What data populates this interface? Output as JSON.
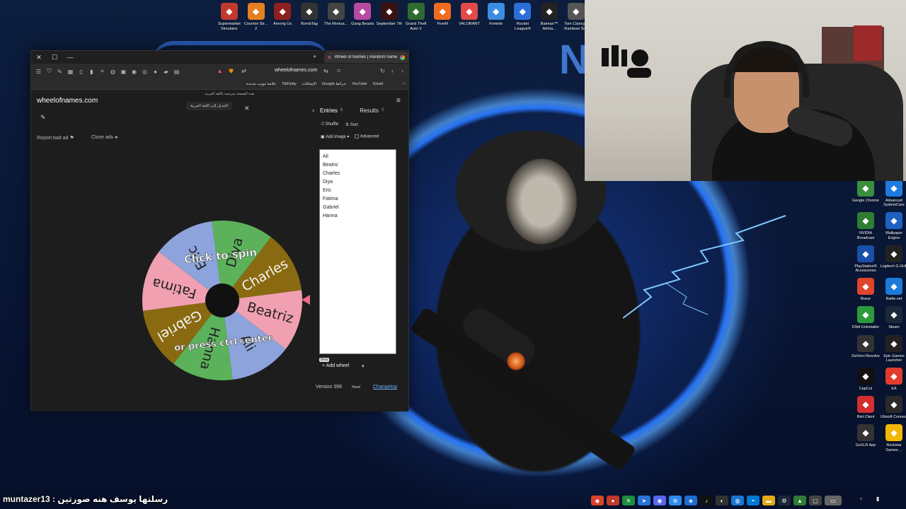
{
  "desktop": {
    "top_icons": [
      {
        "label": "Supermarket Simulator",
        "icon": "supermarket-icon",
        "color": "#c0392b"
      },
      {
        "label": "Counter-Str... 2",
        "icon": "cs2-icon",
        "color": "#e67e22"
      },
      {
        "label": "Among Us",
        "icon": "among-us-icon",
        "color": "#8e1f1f"
      },
      {
        "label": "BombTag",
        "icon": "bombtag-icon",
        "color": "#333333"
      },
      {
        "label": "The Mortua...",
        "icon": "mortuary-icon",
        "color": "#444444"
      },
      {
        "label": "Gang Beasts",
        "icon": "gang-beasts-icon",
        "color": "#b84aa3"
      },
      {
        "label": "September 7th",
        "icon": "september-icon",
        "color": "#3a1111"
      },
      {
        "label": "Grand Theft Auto V",
        "icon": "gta-icon",
        "color": "#2f6b2f"
      },
      {
        "label": "FiveM",
        "icon": "fivem-icon",
        "color": "#f06b1f"
      },
      {
        "label": "VALORANT",
        "icon": "valorant-icon",
        "color": "#e34a4a"
      },
      {
        "label": "Fortnite",
        "icon": "fortnite-icon",
        "color": "#3b8de0"
      },
      {
        "label": "Rocket League®",
        "icon": "rocket-league-icon",
        "color": "#2a6fd6"
      },
      {
        "label": "Batman™ Arkha...",
        "icon": "batman-icon",
        "color": "#222222"
      },
      {
        "label": "Tom Clancy's Rainbow Si...",
        "icon": "rainbow-six-icon",
        "color": "#555555"
      }
    ],
    "right_icons": [
      {
        "label": "Google Chrome",
        "icon": "chrome-icon",
        "color": "#3b8e3b"
      },
      {
        "label": "Advanced SystemCare",
        "icon": "systemcare-icon",
        "color": "#1f7ae0"
      },
      {
        "label": "NVIDIA Broadcast",
        "icon": "nvidia-icon",
        "color": "#2e7d32"
      },
      {
        "label": "Wallpaper Engine",
        "icon": "wallpaper-engine-icon",
        "color": "#1f5fbf"
      },
      {
        "label": "PlayStation® Accessories",
        "icon": "playstation-icon",
        "color": "#1a4fa8"
      },
      {
        "label": "Logitech G HUB",
        "icon": "logitech-icon",
        "color": "#222222"
      },
      {
        "label": "Brave",
        "icon": "brave-icon",
        "color": "#e0452b"
      },
      {
        "label": "Battle.net",
        "icon": "battlenet-icon",
        "color": "#1c7ad9"
      },
      {
        "label": "IObit Uninstaller",
        "icon": "iobit-icon",
        "color": "#2c9a3c"
      },
      {
        "label": "Steam",
        "icon": "steam-icon",
        "color": "#1b2838"
      },
      {
        "label": "DaVinci Resolve",
        "icon": "davinci-icon",
        "color": "#333333"
      },
      {
        "label": "Epic Games Launcher",
        "icon": "epic-icon",
        "color": "#222222"
      },
      {
        "label": "CapCut",
        "icon": "capcut-icon",
        "color": "#111111"
      },
      {
        "label": "EA",
        "icon": "ea-icon",
        "color": "#e23c2c"
      },
      {
        "label": "Riot Client",
        "icon": "riot-icon",
        "color": "#d32f2f"
      },
      {
        "label": "Ubisoft Connect",
        "icon": "ubisoft-icon",
        "color": "#2a2a2a"
      },
      {
        "label": "GoXLR App",
        "icon": "goxlr-icon",
        "color": "#333333"
      },
      {
        "label": "Rockstar Games ...",
        "icon": "rockstar-icon",
        "color": "#f2b705"
      }
    ]
  },
  "browser": {
    "tab_title": "Wheel of Names | Random name",
    "url": "wheelofnames.com",
    "bookmarks": [
      "علامة تبويب جديدة",
      "TikFinity",
      "الإضافات",
      "Google خرائط",
      "YouTube",
      "Gmail"
    ],
    "translate_popup": {
      "text": "هذه الصفحة مترجمة باللغة العربية",
      "button": "التبديل إلى اللغة العربية"
    }
  },
  "page": {
    "site_title": "wheelofnames.com",
    "report_ad": "Report bad ad",
    "close_ads": "Close ads",
    "wheel": {
      "click_to_spin": "Click to spin",
      "or_press": "or press ctrl+enter",
      "slices": [
        {
          "name": "Ali",
          "color": "#8da3dc"
        },
        {
          "name": "Beatriz",
          "color": "#f0a0b0"
        },
        {
          "name": "Charles",
          "color": "#8a6a10"
        },
        {
          "name": "Diya",
          "color": "#5bb25b"
        },
        {
          "name": "Eric",
          "color": "#8da3dc"
        },
        {
          "name": "Fatima",
          "color": "#f0a0b0"
        },
        {
          "name": "Gabriel",
          "color": "#8a6a10"
        },
        {
          "name": "Hanna",
          "color": "#5bb25b"
        }
      ]
    },
    "panel": {
      "entries_label": "Entries",
      "entries_count": "8",
      "results_label": "Results",
      "results_count": "0",
      "shuffle": "Shuffle",
      "sort": "Sort",
      "add_image": "Add image",
      "advanced": "Advanced",
      "entries": [
        "Ali",
        "Beatriz",
        "Charles",
        "Diya",
        "Eric",
        "Fatima",
        "Gabriel",
        "Hanna"
      ],
      "beta": "Beta",
      "add_wheel": "Add wheel",
      "version": "Version 396",
      "new_badge": "New!",
      "changelog": "Changelog"
    }
  },
  "chat": {
    "username": "muntazer13",
    "message": "رسلتها يوسف هنه صورتين"
  }
}
